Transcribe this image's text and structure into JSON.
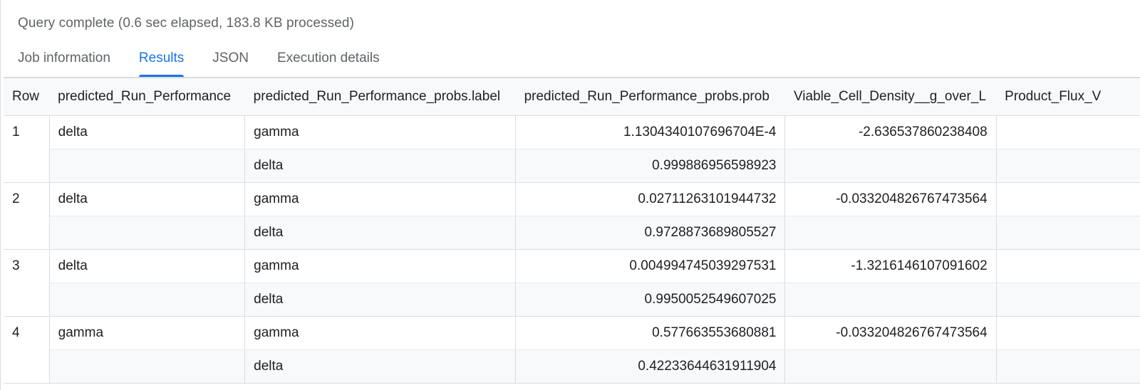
{
  "status_text": "Query complete (0.6 sec elapsed, 183.8 KB processed)",
  "tabs": [
    {
      "label": "Job information",
      "active": false
    },
    {
      "label": "Results",
      "active": true
    },
    {
      "label": "JSON",
      "active": false
    },
    {
      "label": "Execution details",
      "active": false
    }
  ],
  "table": {
    "headers": {
      "row": "Row",
      "predicted": "predicted_Run_Performance",
      "label": "predicted_Run_Performance_probs.label",
      "prob": "predicted_Run_Performance_probs.prob",
      "vcd": "Viable_Cell_Density__g_over_L",
      "product_flux": "Product_Flux_V"
    },
    "rows": [
      {
        "row": "1",
        "predicted": "delta",
        "vcd": "-2.636537860238408",
        "probs": [
          {
            "label": "gamma",
            "prob": "1.1304340107696704E-4"
          },
          {
            "label": "delta",
            "prob": "0.999886956598923"
          }
        ]
      },
      {
        "row": "2",
        "predicted": "delta",
        "vcd": "-0.033204826767473564",
        "probs": [
          {
            "label": "gamma",
            "prob": "0.02711263101944732"
          },
          {
            "label": "delta",
            "prob": "0.9728873689805527"
          }
        ]
      },
      {
        "row": "3",
        "predicted": "delta",
        "vcd": "-1.3216146107091602",
        "probs": [
          {
            "label": "gamma",
            "prob": "0.004994745039297531"
          },
          {
            "label": "delta",
            "prob": "0.9950052549607025"
          }
        ]
      },
      {
        "row": "4",
        "predicted": "gamma",
        "vcd": "-0.033204826767473564",
        "probs": [
          {
            "label": "gamma",
            "prob": "0.577663553680881"
          },
          {
            "label": "delta",
            "prob": "0.42233644631911904"
          }
        ]
      }
    ]
  }
}
